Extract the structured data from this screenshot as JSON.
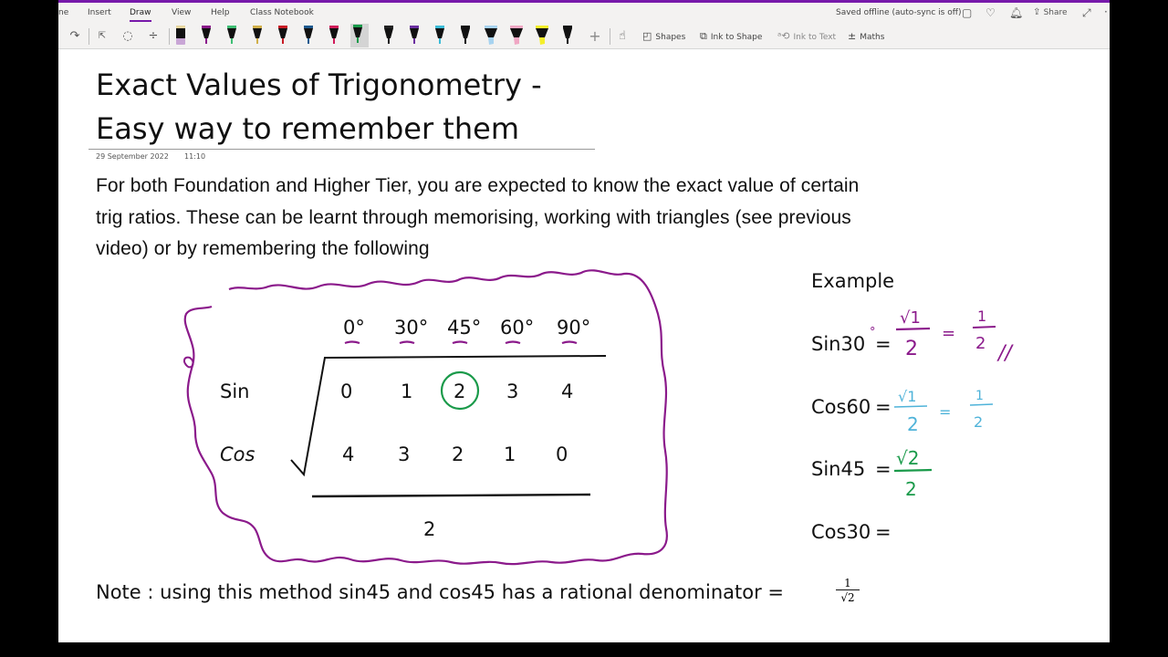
{
  "ribbon": {
    "tabs": [
      {
        "label": "ne"
      },
      {
        "label": "Insert"
      },
      {
        "label": "Draw"
      },
      {
        "label": "View"
      },
      {
        "label": "Help"
      },
      {
        "label": "Class Notebook"
      }
    ],
    "active_tab": "Draw",
    "status": "Saved offline (auto-sync is off)",
    "share_label": "Share",
    "accent_color": "#7719aa",
    "icons": [
      "sticky-notes-icon",
      "lightbulb-icon",
      "bell-icon",
      "share-icon",
      "expand-icon",
      "more-icon"
    ]
  },
  "draw_toolbar": {
    "tools": [
      {
        "name": "redo-icon",
        "glyph": "↷"
      },
      {
        "name": "type-select-icon",
        "glyph": "ᴬI"
      },
      {
        "name": "lasso-select-icon",
        "glyph": "◌"
      },
      {
        "name": "add-space-icon",
        "glyph": "÷"
      }
    ],
    "pens": [
      {
        "type": "eraser",
        "color": "#c9a6d6"
      },
      {
        "type": "pen",
        "color": "#8b1a8b"
      },
      {
        "type": "pen",
        "color": "#3fbf74"
      },
      {
        "type": "pen",
        "color": "#d1b04a"
      },
      {
        "type": "pen",
        "color": "#c81c25"
      },
      {
        "type": "pen",
        "color": "#1f5a8f"
      },
      {
        "type": "pen",
        "color": "#d11b5a"
      },
      {
        "type": "pen",
        "color": "#1a9a4a",
        "selected": true
      },
      {
        "type": "pen",
        "color": "#222222"
      },
      {
        "type": "pen",
        "color": "#6b2fa0"
      },
      {
        "type": "pen",
        "color": "#3bbcd8"
      },
      {
        "type": "pencil",
        "color": "#111111"
      },
      {
        "type": "highlighter",
        "color": "#a7d3f0"
      },
      {
        "type": "highlighter",
        "color": "#f0a7c4"
      },
      {
        "type": "highlighter",
        "color": "#f5ef2a"
      },
      {
        "type": "pen",
        "color": "#111111"
      }
    ],
    "add_pen_glyph": "+",
    "buttons": [
      {
        "label": "Shapes",
        "glyph": "◰",
        "disabled": false
      },
      {
        "label": "Ink to Shape",
        "glyph": "⧉",
        "disabled": false
      },
      {
        "label": "Ink to Text",
        "glyph": "ᵃ",
        "disabled": true
      },
      {
        "label": "Maths",
        "glyph": "±",
        "disabled": false
      }
    ]
  },
  "page": {
    "title_line1": "Exact Values of Trigonometry -",
    "title_line2": "Easy way to remember them",
    "date": "29 September 2022",
    "time": "11:10",
    "paragraph": [
      "For both Foundation and Higher Tier, you are expected to know the exact value of certain",
      "trig ratios. These can be learnt through memorising, working with triangles (see previous",
      "video) or by remembering the following"
    ],
    "table": {
      "angles": [
        "0°",
        "30°",
        "45°",
        "60°",
        "90°"
      ],
      "rows": [
        {
          "label": "Sin",
          "values": [
            "0",
            "1",
            "2",
            "3",
            "4"
          ]
        },
        {
          "label": "Cos",
          "values": [
            "4",
            "3",
            "2",
            "1",
            "0"
          ]
        }
      ],
      "denominator": "2",
      "circled": {
        "row": "Sin",
        "angle": "45°"
      },
      "border_color": "#8b1a8b",
      "circle_color": "#1a9a4a"
    },
    "example": {
      "heading": "Example",
      "lines": [
        {
          "lhs": "Sin30",
          "degree_mark": "°",
          "eq": "=",
          "num": "√1",
          "den": "2",
          "eq2": "=",
          "num2": "1",
          "den2": "2",
          "mark": "//",
          "color": "#8b1a8b"
        },
        {
          "lhs": "Cos60",
          "eq": "=",
          "num": "√1",
          "den": "2",
          "eq2": "=",
          "num2": "1",
          "den2": "2",
          "color": "#4fb3d9"
        },
        {
          "lhs": "Sin45",
          "eq": "=",
          "num": "√2",
          "den": "2",
          "color": "#1a9a4a"
        },
        {
          "lhs": "Cos30",
          "eq": "="
        }
      ]
    },
    "note": "Note : using this method sin45 and cos45 has a rational denominator =",
    "note_fraction": {
      "num": "1",
      "den": "√2"
    }
  }
}
